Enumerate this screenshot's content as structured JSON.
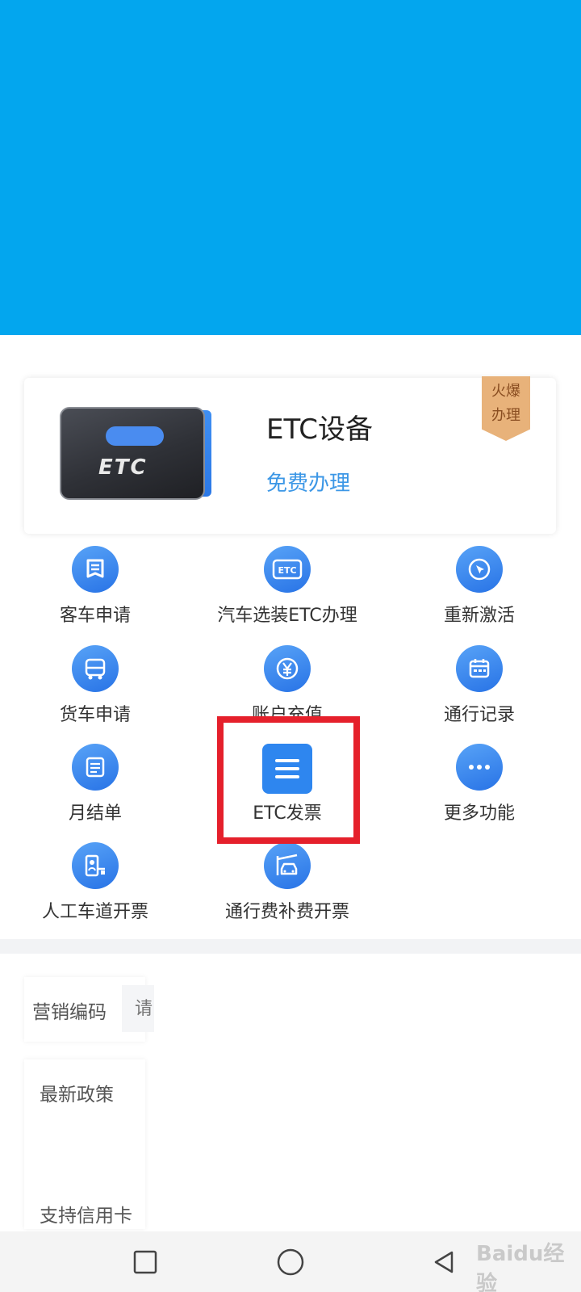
{
  "etc_card": {
    "title": "ETC设备",
    "subtitle": "免费办理",
    "badge_line1": "火爆",
    "badge_line2": "办理",
    "device_text": "ETC"
  },
  "menu": [
    {
      "label": "客车申请",
      "icon": "receipt-icon"
    },
    {
      "label": "汽车选装ETC办理",
      "icon": "etc-tag-icon"
    },
    {
      "label": "重新激活",
      "icon": "cursor-click-icon"
    },
    {
      "label": "货车申请",
      "icon": "truck-icon"
    },
    {
      "label": "账户充值",
      "icon": "yen-coin-icon"
    },
    {
      "label": "通行记录",
      "icon": "calendar-icon"
    },
    {
      "label": "月结单",
      "icon": "statement-icon"
    },
    {
      "label": "ETC发票",
      "icon": "ticket-icon"
    },
    {
      "label": "更多功能",
      "icon": "more-dots-icon"
    },
    {
      "label": "人工车道开票",
      "icon": "toll-booth-icon"
    },
    {
      "label": "通行费补费开票",
      "icon": "car-barrier-icon"
    }
  ],
  "marketing": {
    "label": "营销编码",
    "placeholder": "请"
  },
  "policy": {
    "title": "最新政策",
    "item": "支持信用卡"
  },
  "watermark": "Baidu经验",
  "colors": {
    "banner": "#03a6ee",
    "accent": "#2e86ef",
    "highlight": "#e5202b",
    "badge": "#e8b27a"
  }
}
